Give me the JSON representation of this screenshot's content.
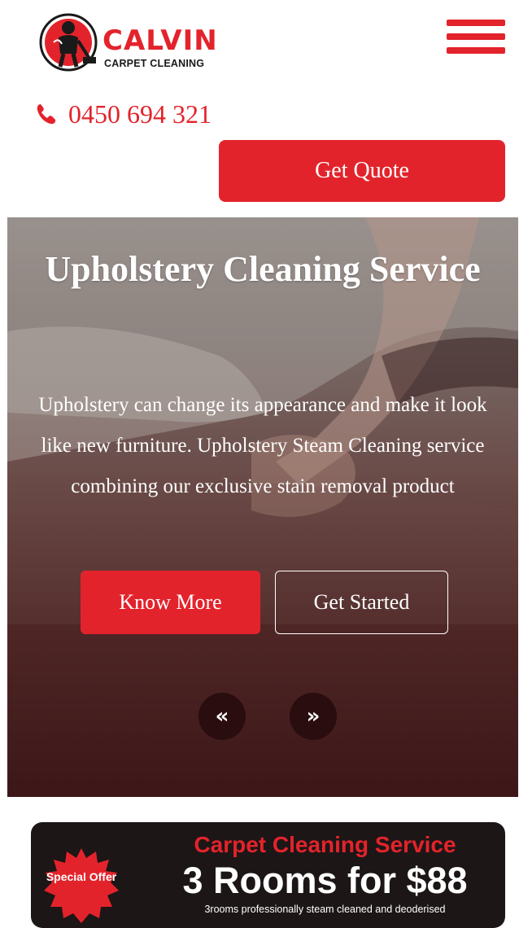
{
  "brand": {
    "name": "CALVIN",
    "tagline": "CARPET CLEANING",
    "color_primary": "#e3232b",
    "color_dark": "#1a1a1a"
  },
  "header": {
    "menu_icon": "hamburger-menu-icon",
    "phone_icon": "phone-icon",
    "phone": "0450 694 321",
    "quote_label": "Get Quote"
  },
  "hero": {
    "title": "Upholstery Cleaning Service",
    "description": "Upholstery can change its appearance and make it look like new furniture. Upholstery Steam Cleaning service combining our exclusive stain removal product",
    "primary_button": "Know More",
    "secondary_button": "Get Started",
    "prev_label": "«",
    "next_label": "»"
  },
  "offer": {
    "badge": "Special Offer",
    "title": "Carpet Cleaning Service",
    "headline": "3 Rooms for $88",
    "subtitle": "3rooms professionally steam cleaned and deoderised"
  }
}
